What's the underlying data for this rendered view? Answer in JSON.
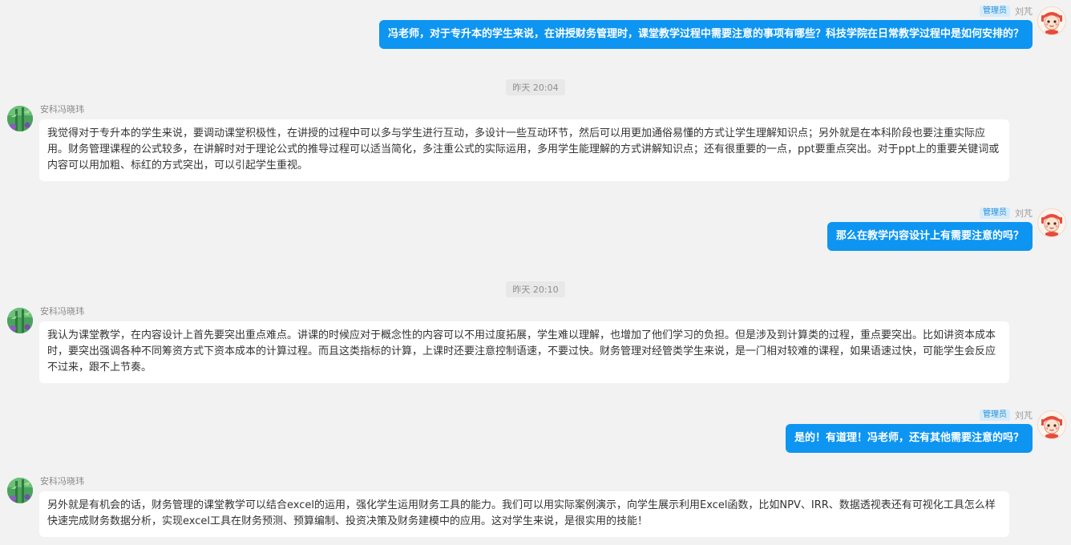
{
  "self": {
    "badge": "管理员",
    "name": "刘芃"
  },
  "other": {
    "name": "安科冯晓玮"
  },
  "messages": {
    "m1": "冯老师，对于专升本的学生来说，在讲授财务管理时，课堂教学过程中需要注意的事项有哪些？科技学院在日常教学过程中是如何安排的？",
    "t1": "昨天 20:04",
    "m2": "我觉得对于专升本的学生来说，要调动课堂积极性，在讲授的过程中可以多与学生进行互动，多设计一些互动环节，然后可以用更加通俗易懂的方式让学生理解知识点；另外就是在本科阶段也要注重实际应用。财务管理课程的公式较多，在讲解时对于理论公式的推导过程可以适当简化，多注重公式的实际运用，多用学生能理解的方式讲解知识点；还有很重要的一点，ppt要重点突出。对于ppt上的重要关键词或内容可以用加粗、标红的方式突出，可以引起学生重视。",
    "m3": "那么在教学内容设计上有需要注意的吗？",
    "t2": "昨天 20:10",
    "m4": "我认为课堂教学，在内容设计上首先要突出重点难点。讲课的时候应对于概念性的内容可以不用过度拓展，学生难以理解，也增加了他们学习的负担。但是涉及到计算类的过程，重点要突出。比如讲资本成本时，要突出强调各种不同筹资方式下资本成本的计算过程。而且这类指标的计算，上课时还要注意控制语速，不要过快。财务管理对经管类学生来说，是一门相对较难的课程，如果语速过快，可能学生会反应不过来，跟不上节奏。",
    "m5": "是的！有道理！冯老师，还有其他需要注意的吗？",
    "m6": "另外就是有机会的话，财务管理的课堂教学可以结合excel的运用，强化学生运用财务工具的能力。我们可以用实际案例演示，向学生展示利用Excel函数，比如NPV、IRR、数据透视表还有可视化工具怎么样快速完成财务数据分析，实现excel工具在财务预测、预算编制、投资决策及财务建模中的应用。这对学生来说，是很实用的技能！"
  },
  "colors": {
    "self_bubble": "#0d95f1",
    "other_bubble": "#ffffff",
    "background": "#f2f2f2",
    "badge_bg": "#d6ecfb",
    "badge_text": "#2a8fd8"
  },
  "icons": {
    "self_avatar": "cartoon-avatar-icon",
    "other_avatar": "bamboo-avatar-icon"
  }
}
